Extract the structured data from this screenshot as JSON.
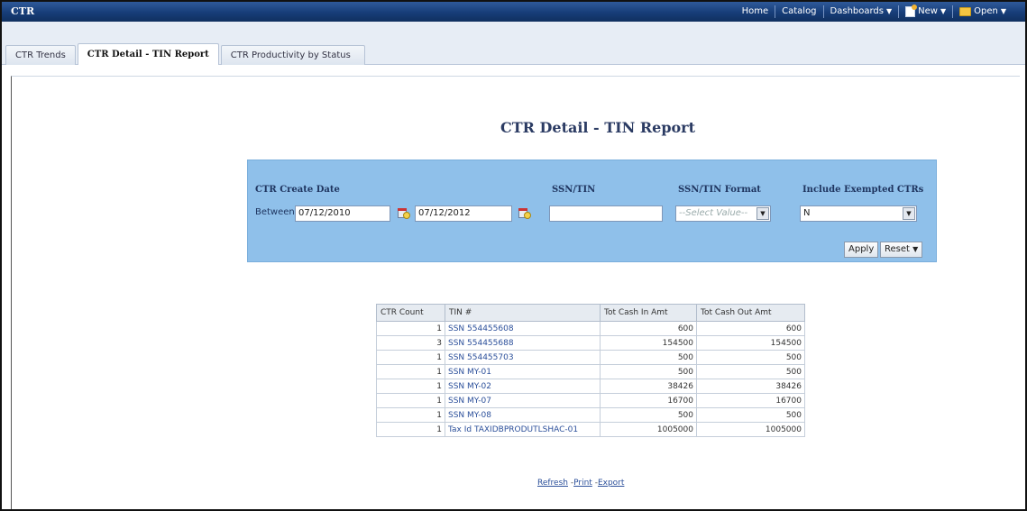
{
  "app": {
    "title": "CTR"
  },
  "topnav": {
    "home": "Home",
    "catalog": "Catalog",
    "dashboards": "Dashboards",
    "new": "New",
    "open": "Open"
  },
  "tabs": [
    {
      "label": "CTR Trends"
    },
    {
      "label": "CTR Detail - TIN Report"
    },
    {
      "label": "CTR Productivity by Status"
    }
  ],
  "report": {
    "title": "CTR Detail - TIN Report"
  },
  "prompts": {
    "create_date_label": "CTR Create Date",
    "between_label": "Between",
    "date_from": "07/12/2010",
    "date_to": "07/12/2012",
    "ssn_label": "SSN/TIN",
    "ssn_value": "",
    "format_label": "SSN/TIN Format",
    "format_placeholder": "--Select Value--",
    "exempt_label": "Include Exempted CTRs",
    "exempt_value": "N",
    "apply": "Apply",
    "reset": "Reset"
  },
  "table": {
    "headers": [
      "CTR Count",
      "TIN #",
      "Tot Cash In Amt",
      "Tot Cash Out Amt"
    ],
    "rows": [
      [
        "1",
        "SSN 554455608",
        "600",
        "600"
      ],
      [
        "3",
        "SSN 554455688",
        "154500",
        "154500"
      ],
      [
        "1",
        "SSN 554455703",
        "500",
        "500"
      ],
      [
        "1",
        "SSN MY-01",
        "500",
        "500"
      ],
      [
        "1",
        "SSN MY-02",
        "38426",
        "38426"
      ],
      [
        "1",
        "SSN MY-07",
        "16700",
        "16700"
      ],
      [
        "1",
        "SSN MY-08",
        "500",
        "500"
      ],
      [
        "1",
        "Tax Id TAXIDBPRODUTLSHAC-01",
        "1005000",
        "1005000"
      ]
    ]
  },
  "footer_links": {
    "refresh": "Refresh",
    "print": "Print",
    "export": "Export"
  }
}
